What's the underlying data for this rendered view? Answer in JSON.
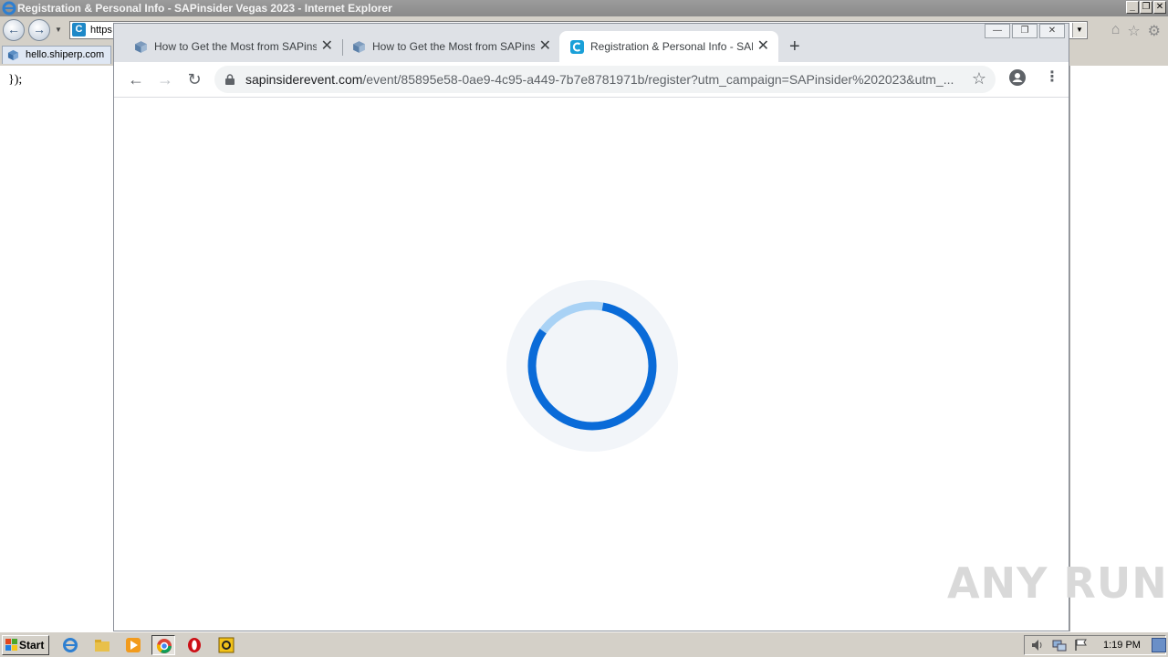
{
  "ie": {
    "title": "Registration & Personal Info - SAPinsider Vegas 2023 - Internet Explorer",
    "address_visible": "https",
    "tab_label": "hello.shiperp.com",
    "page_code": "});"
  },
  "chrome": {
    "tabs": [
      {
        "label": "How to Get the Most from SAPinsider",
        "icon": "cube-icon",
        "active": false
      },
      {
        "label": "How to Get the Most from SAPinsider",
        "icon": "cube-icon",
        "active": false
      },
      {
        "label": "Registration & Personal Info - SAPinsider",
        "icon": "c-logo-icon",
        "active": true
      }
    ],
    "url_host": "sapinsiderevent.com",
    "url_path": "/event/85895e58-0ae9-4c95-a449-7b7e8781971b/register?utm_campaign=SAPinsider%202023&utm_...",
    "page_state": "loading",
    "spinner_progress": 0.82
  },
  "taskbar": {
    "start_label": "Start",
    "apps": [
      "internet-explorer-icon",
      "folder-icon",
      "media-player-icon",
      "chrome-icon",
      "opera-icon",
      "norton-icon"
    ],
    "clock": "1:19 PM"
  },
  "watermark": "ANY RUN",
  "colors": {
    "spinner": "#0a6bd8",
    "spinner_track": "#a9d2f5",
    "chrome_tabstrip": "#dee1e6"
  }
}
